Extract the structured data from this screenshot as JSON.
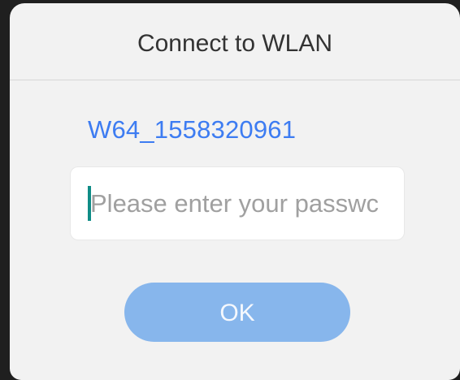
{
  "dialog": {
    "title": "Connect to WLAN",
    "network_name": "W64_1558320961",
    "password_field": {
      "value": "",
      "placeholder": "Please enter your passwc"
    },
    "ok_label": "OK"
  },
  "colors": {
    "network_name": "#3d7cf2",
    "ok_button_bg": "#87b6ec",
    "caret": "#0f8c86",
    "dialog_bg": "#f2f2f2"
  }
}
